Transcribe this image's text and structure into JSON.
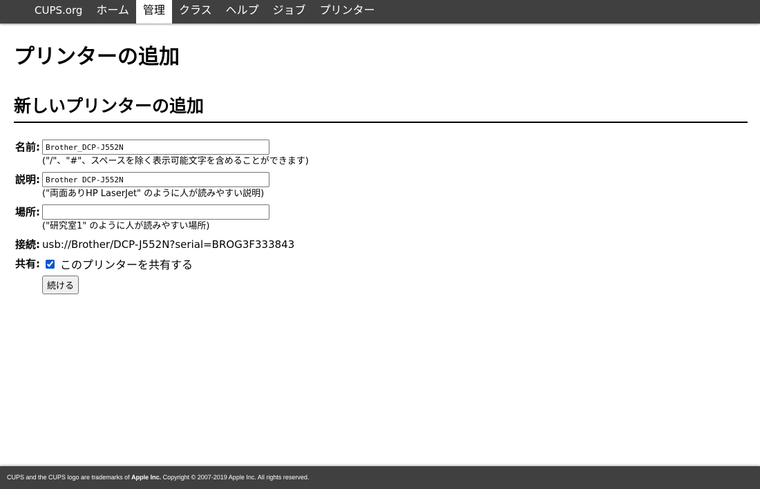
{
  "nav": {
    "brand": "CUPS.org",
    "items": [
      {
        "label": "ホーム",
        "active": false
      },
      {
        "label": "管理",
        "active": true
      },
      {
        "label": "クラス",
        "active": false
      },
      {
        "label": "ヘルプ",
        "active": false
      },
      {
        "label": "ジョブ",
        "active": false
      },
      {
        "label": "プリンター",
        "active": false
      }
    ]
  },
  "page": {
    "title": "プリンターの追加",
    "section_title": "新しいプリンターの追加"
  },
  "form": {
    "name": {
      "label": "名前:",
      "value": "Brother_DCP-J552N",
      "hint": "(\"/\"、\"#\"、スペースを除く表示可能文字を含めることができます)"
    },
    "description": {
      "label": "説明:",
      "value": "Brother DCP-J552N",
      "hint": "(\"両面ありHP LaserJet\" のように人が読みやすい説明)"
    },
    "location": {
      "label": "場所:",
      "value": "",
      "hint": "(\"研究室1\" のように人が読みやすい場所)"
    },
    "connection": {
      "label": "接続:",
      "value": "usb://Brother/DCP-J552N?serial=BROG3F333843"
    },
    "sharing": {
      "label": "共有:",
      "checkbox_label": "このプリンターを共有する",
      "checked": true
    },
    "continue_label": "続ける"
  },
  "footer": {
    "prefix": "CUPS and the CUPS logo are trademarks of ",
    "company": "Apple Inc.",
    "suffix": " Copyright © 2007-2019 Apple Inc. All rights reserved."
  }
}
